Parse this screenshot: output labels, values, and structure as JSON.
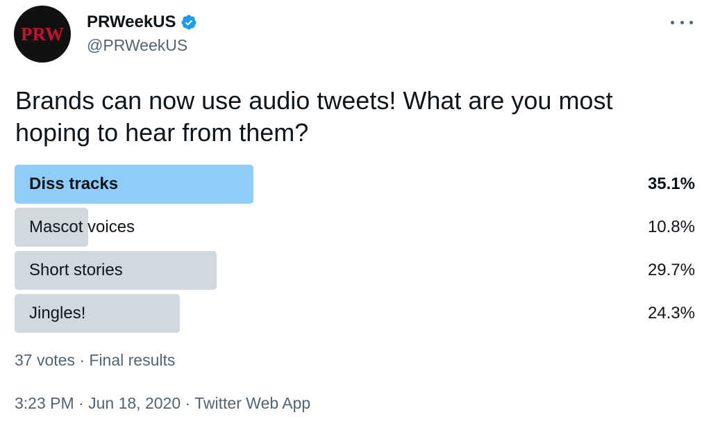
{
  "author": {
    "avatar_text": "PRW",
    "display_name": "PRWeekUS",
    "handle": "@PRWeekUS",
    "verified_icon": "verified-badge-icon",
    "verified_color": "#1d9bf0"
  },
  "more_icon": "more-horizontal-icon",
  "tweet": {
    "text": "Brands can now use audio tweets! What are you most hoping to hear from them?"
  },
  "poll": {
    "options": [
      {
        "label": "Diss tracks",
        "percent_text": "35.1%",
        "percent": 35.1,
        "winner": true
      },
      {
        "label": "Mascot voices",
        "percent_text": "10.8%",
        "percent": 10.8,
        "winner": false
      },
      {
        "label": "Short stories",
        "percent_text": "29.7%",
        "percent": 29.7,
        "winner": false
      },
      {
        "label": "Jingles!",
        "percent_text": "24.3%",
        "percent": 24.3,
        "winner": false
      }
    ],
    "summary": "37 votes · Final results",
    "winner_color": "#8ecdf8",
    "bar_color": "#cfd9de"
  },
  "meta": {
    "time": "3:23 PM",
    "date": "Jun 18, 2020",
    "source": "Twitter Web App",
    "separator": " · "
  }
}
